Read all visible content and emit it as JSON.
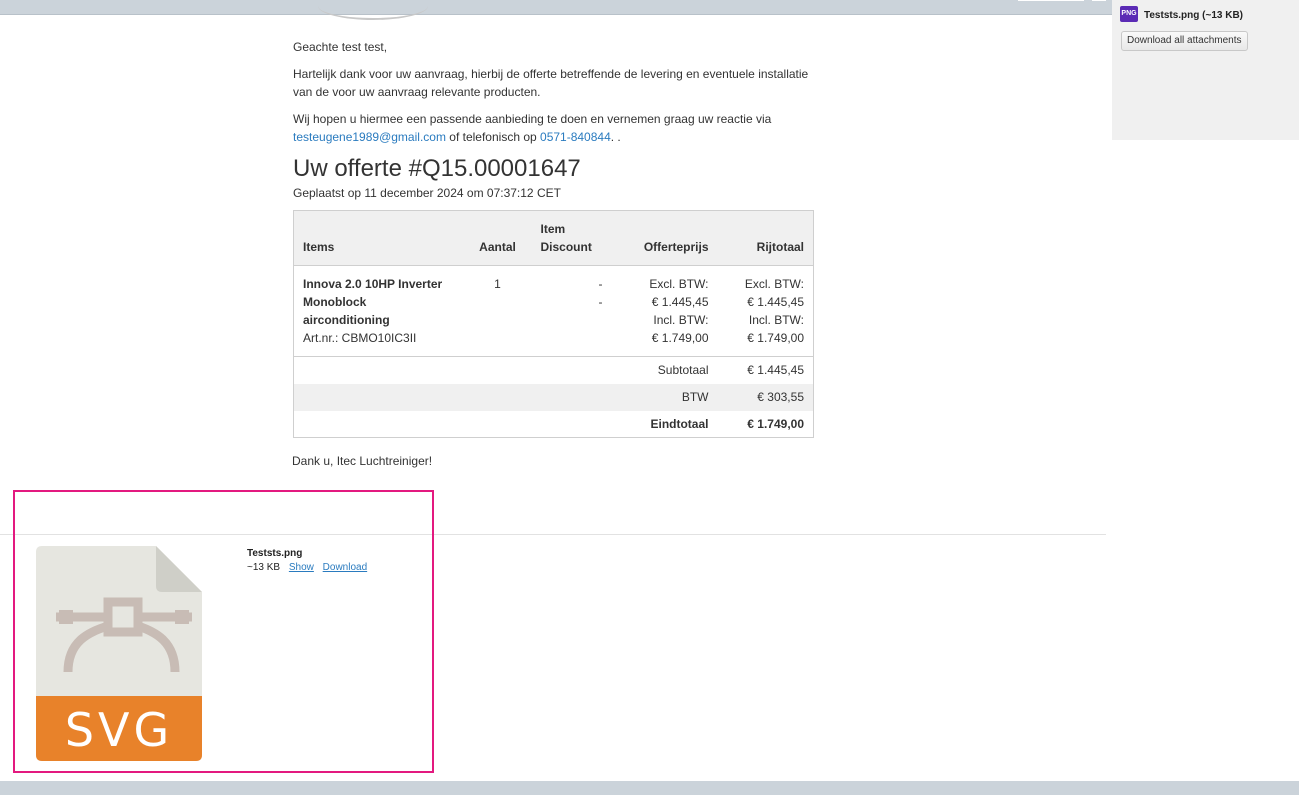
{
  "header": {
    "right_attachment": {
      "badge": "PNG",
      "name": "Teststs.png (~13 KB)"
    },
    "download_all_label": "Download all attachments"
  },
  "message": {
    "greeting": "Geachte test test,",
    "paragraph1": "Hartelijk dank voor uw aanvraag, hierbij de offerte betreffende de levering en eventuele installatie van de voor uw aanvraag relevante producten.",
    "paragraph2_prefix": "Wij hopen u hiermee een passende aanbieding te doen en vernemen graag uw reactie via",
    "email": "testeugene1989@gmail.com",
    "paragraph2_middle": " of telefonisch op ",
    "phone": "0571-840844",
    "paragraph2_suffix": ". .",
    "offer_title": "Uw offerte #Q15.00001647",
    "placed": "Geplaatst op 11 december 2024 om 07:37:12 CET",
    "thanks": "Dank u, Itec Luchtreiniger!"
  },
  "table": {
    "headers": {
      "items": "Items",
      "qty": "Aantal",
      "discount_line1": "Item",
      "discount_line2": "Discount",
      "price": "Offerteprijs",
      "row_total": "Rijtotaal"
    },
    "item": {
      "name_line1": "Innova 2.0 10HP Inverter",
      "name_line2": "Monoblock",
      "name_line3": "airconditioning",
      "sku": "Art.nr.: CBMO10IC3II",
      "qty": "1",
      "discount1": "-",
      "discount2": "-",
      "price_excl_label": "Excl. BTW:",
      "price_excl": "€ 1.445,45",
      "price_incl_label": "Incl. BTW:",
      "price_incl": "€ 1.749,00",
      "total_excl_label": "Excl. BTW:",
      "total_excl": "€ 1.445,45",
      "total_incl_label": "Incl. BTW:",
      "total_incl": "€ 1.749,00"
    },
    "totals": {
      "subtotal_label": "Subtotaal",
      "subtotal": "€ 1.445,45",
      "tax_label": "BTW",
      "tax": "€ 303,55",
      "grand_label": "Eindtotaal",
      "grand": "€ 1.749,00"
    }
  },
  "attachment": {
    "icon_label": "SVG",
    "name": "Teststs.png",
    "size": "~13 KB",
    "show_label": "Show",
    "download_label": "Download"
  },
  "colors": {
    "link": "#2a7bbf",
    "highlight": "#e3197f",
    "svg_band": "#e8822a",
    "icon_paper": "#e6e6e0"
  }
}
